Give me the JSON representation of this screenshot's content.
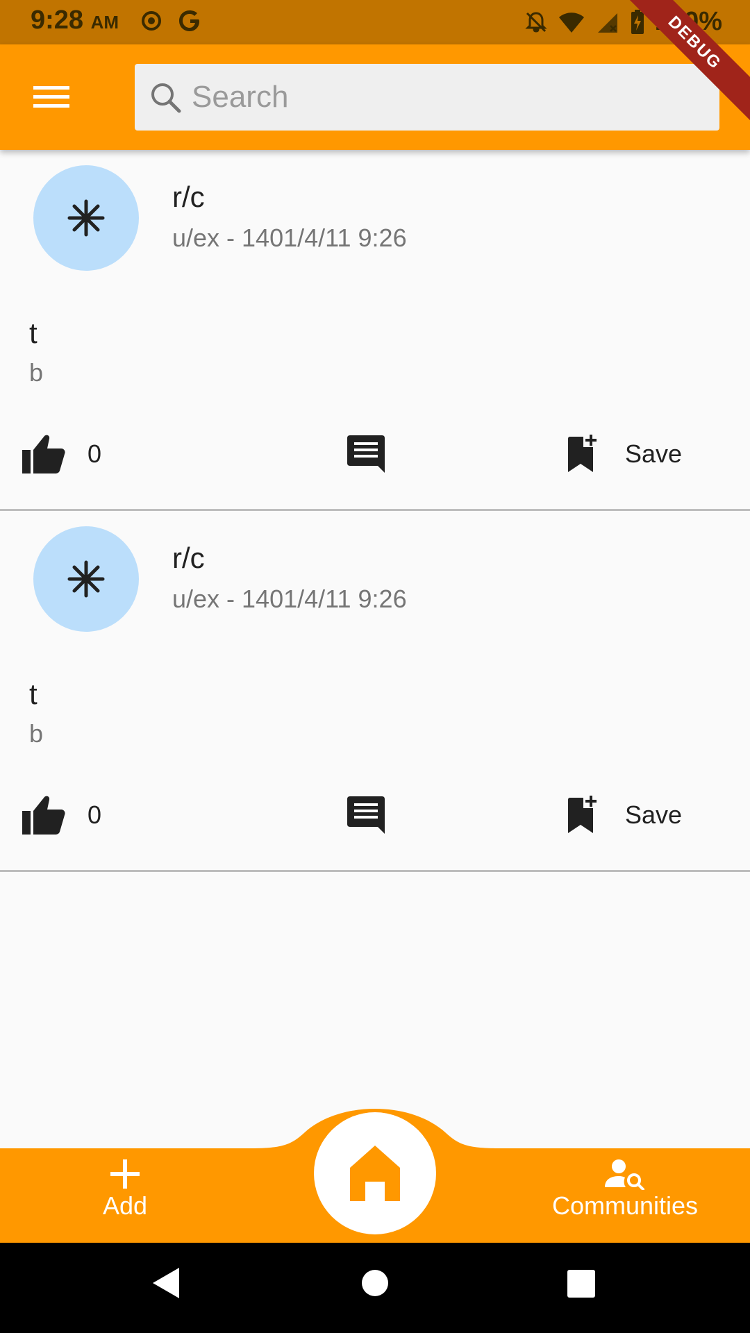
{
  "status_bar": {
    "time": "9:28",
    "ampm": "AM",
    "battery": "100%",
    "icons": [
      "radio-icon",
      "google-icon",
      "notifications-off-icon",
      "wifi-icon",
      "signal-icon",
      "battery-charging-icon"
    ]
  },
  "debug_banner": "DEBUG",
  "app_bar": {
    "menu_icon": "menu-icon",
    "search_placeholder": "Search",
    "search_value": ""
  },
  "posts": [
    {
      "community": "r/c",
      "meta": "u/ex - 1401/4/11 9:26",
      "title": "t",
      "body": "b",
      "likes": "0",
      "save_label": "Save",
      "avatar_icon": "snowflake-icon"
    },
    {
      "community": "r/c",
      "meta": "u/ex - 1401/4/11 9:26",
      "title": "t",
      "body": "b",
      "likes": "0",
      "save_label": "Save",
      "avatar_icon": "snowflake-icon"
    }
  ],
  "bottom_nav": {
    "add_label": "Add",
    "communities_label": "Communities",
    "home_icon": "home-icon"
  },
  "colors": {
    "status_bar": "#C17400",
    "primary": "#FF9800",
    "avatar_bg": "#BBDEFB",
    "background": "#FAFAFA"
  }
}
